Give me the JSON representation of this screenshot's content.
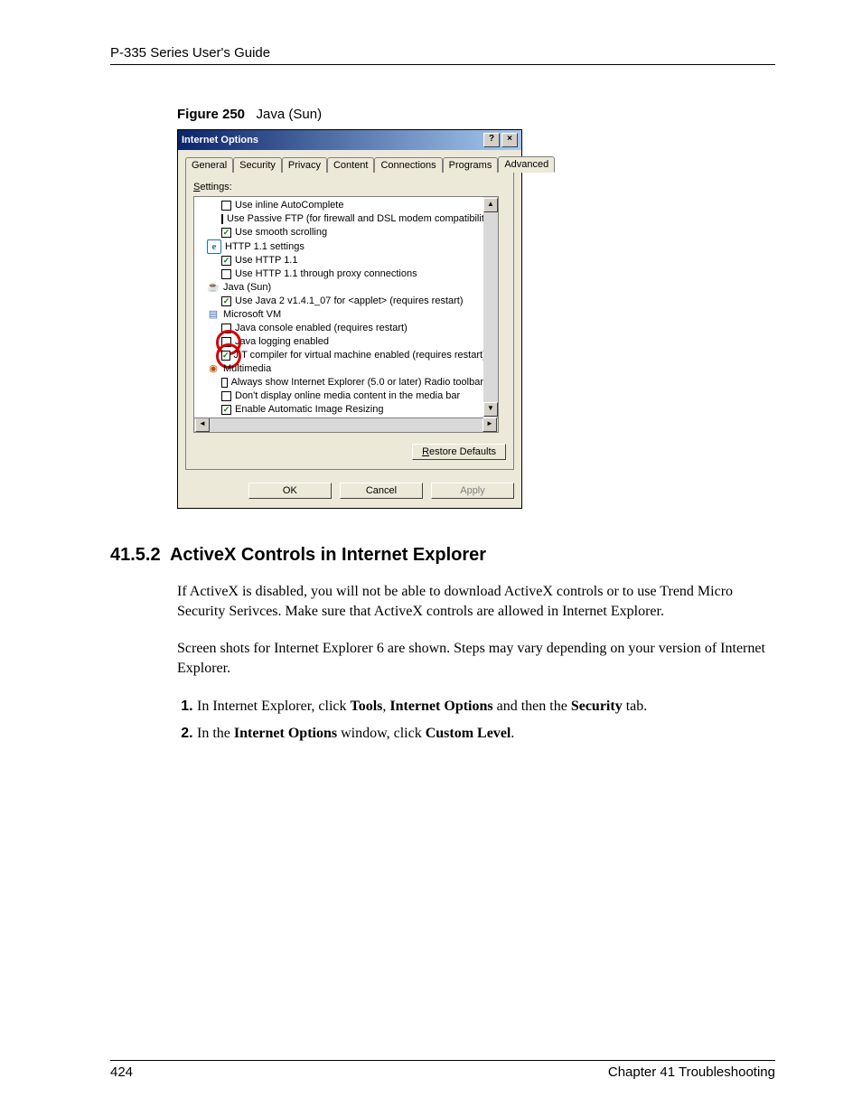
{
  "header": {
    "guide_title": "P-335 Series User's Guide"
  },
  "figure": {
    "label": "Figure 250",
    "title": "Java (Sun)"
  },
  "dialog": {
    "title": "Internet Options",
    "tabs": [
      "General",
      "Security",
      "Privacy",
      "Content",
      "Connections",
      "Programs",
      "Advanced"
    ],
    "active_tab": "Advanced",
    "settings_label_prefix": "S",
    "settings_label_rest": "ettings:",
    "tree": [
      {
        "type": "check",
        "checked": false,
        "indent": 1,
        "label": "Use inline AutoComplete"
      },
      {
        "type": "check",
        "checked": false,
        "indent": 1,
        "label": "Use Passive FTP (for firewall and DSL modem compatibility)"
      },
      {
        "type": "check",
        "checked": true,
        "indent": 1,
        "label": "Use smooth scrolling"
      },
      {
        "type": "cat",
        "icon": "ie",
        "indent": 0,
        "label": "HTTP 1.1 settings"
      },
      {
        "type": "check",
        "checked": true,
        "indent": 1,
        "label": "Use HTTP 1.1"
      },
      {
        "type": "check",
        "checked": false,
        "indent": 1,
        "label": "Use HTTP 1.1 through proxy connections"
      },
      {
        "type": "cat",
        "icon": "cup",
        "indent": 0,
        "label": "Java (Sun)"
      },
      {
        "type": "check",
        "checked": true,
        "indent": 1,
        "label": "Use Java 2 v1.4.1_07 for <applet> (requires restart)"
      },
      {
        "type": "cat",
        "icon": "doc",
        "indent": 0,
        "label": "Microsoft VM"
      },
      {
        "type": "check",
        "checked": false,
        "indent": 1,
        "label": "Java console enabled (requires restart)"
      },
      {
        "type": "check",
        "checked": false,
        "indent": 1,
        "label": "Java logging enabled",
        "annot": "red-top"
      },
      {
        "type": "check",
        "checked": true,
        "indent": 1,
        "label": "JIT compiler for virtual machine enabled (requires restart)",
        "annot": "red-left"
      },
      {
        "type": "cat",
        "icon": "mm",
        "indent": 0,
        "label": "Multimedia"
      },
      {
        "type": "check",
        "checked": false,
        "indent": 1,
        "label": "Always show Internet Explorer (5.0 or later) Radio toolbar"
      },
      {
        "type": "check",
        "checked": false,
        "indent": 1,
        "label": "Don't display online media content in the media bar"
      },
      {
        "type": "check",
        "checked": true,
        "indent": 1,
        "label": "Enable Automatic Image Resizing"
      }
    ],
    "restore_btn_ul": "R",
    "restore_btn_rest": "estore Defaults",
    "buttons": {
      "ok": "OK",
      "cancel": "Cancel",
      "apply": "Apply"
    }
  },
  "section": {
    "number": "41.5.2",
    "title": "ActiveX Controls in Internet Explorer",
    "p1": "If ActiveX is disabled, you will not be able to download ActiveX controls or to use Trend Micro Security Serivces. Make sure that ActiveX controls are allowed in Internet Explorer.",
    "p2": "Screen shots for Internet Explorer 6 are shown. Steps may vary depending on your version of Internet Explorer.",
    "step1_a": "In Internet Explorer, click ",
    "step1_b": "Tools",
    "step1_c": ", ",
    "step1_d": "Internet Options",
    "step1_e": " and then the ",
    "step1_f": "Security",
    "step1_g": " tab.",
    "step2_a": "In the ",
    "step2_b": "Internet Options",
    "step2_c": " window, click ",
    "step2_d": "Custom Level",
    "step2_e": "."
  },
  "footer": {
    "page": "424",
    "chapter": "Chapter 41 Troubleshooting"
  }
}
